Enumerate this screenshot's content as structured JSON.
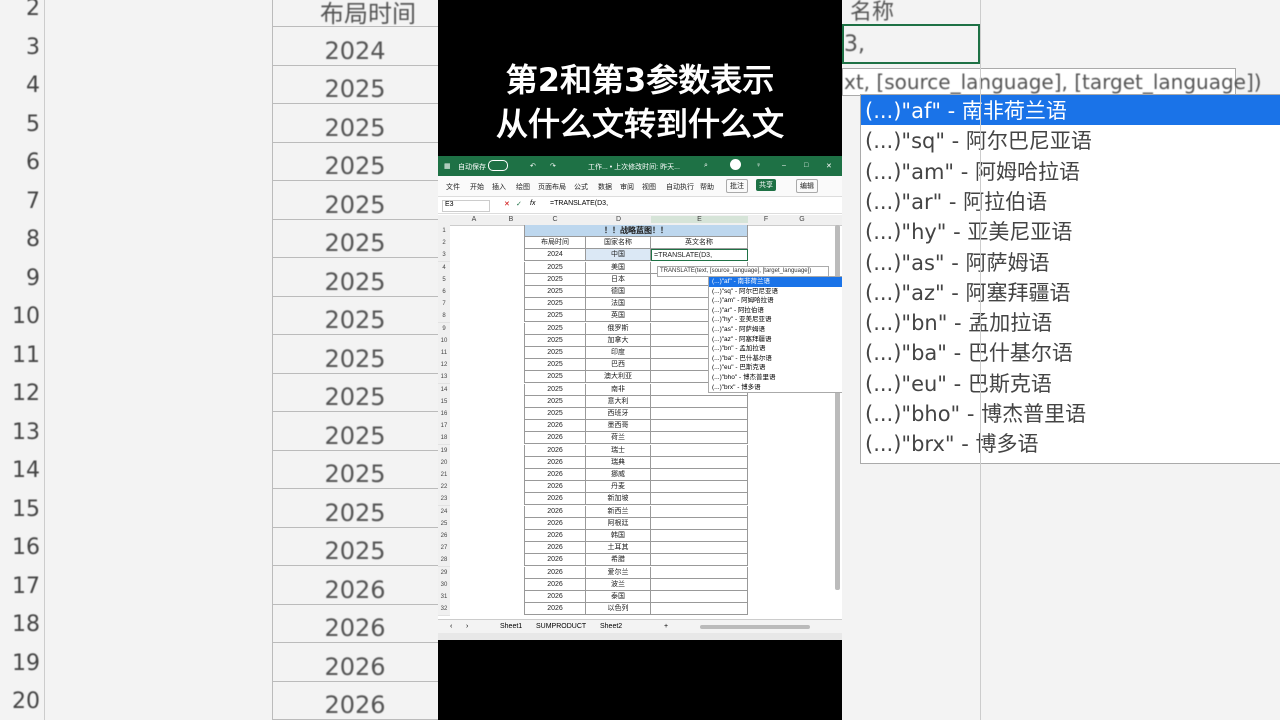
{
  "caption": {
    "line1": "第2和第3参数表示",
    "line2": "从什么文转到什么文"
  },
  "background_left": {
    "header_text": "布局时间",
    "row_numbers": [
      "2",
      "3",
      "4",
      "5",
      "6",
      "7",
      "8",
      "9",
      "10",
      "11",
      "12",
      "13",
      "14",
      "15",
      "16",
      "17",
      "18",
      "19",
      "20"
    ],
    "years": [
      "2024",
      "2025",
      "2025",
      "2025",
      "2025",
      "2025",
      "2025",
      "2025",
      "2025",
      "2025",
      "2025",
      "2025",
      "2025",
      "2025",
      "2026",
      "2026",
      "2026",
      "2026"
    ]
  },
  "background_right": {
    "header_fragment": "名称",
    "cell_fragment": "3,",
    "tooltip": "xt, [source_language], [target_language])",
    "options": [
      "(...)\"af\" - 南非荷兰语",
      "(...)\"sq\" - 阿尔巴尼亚语",
      "(...)\"am\" - 阿姆哈拉语",
      "(...)\"ar\" - 阿拉伯语",
      "(...)\"hy\" - 亚美尼亚语",
      "(...)\"as\" - 阿萨姆语",
      "(...)\"az\" - 阿塞拜疆语",
      "(...)\"bn\" - 孟加拉语",
      "(...)\"ba\" - 巴什基尔语",
      "(...)\"eu\" - 巴斯克语",
      "(...)\"bho\" - 博杰普里语",
      "(...)\"brx\" - 博多语"
    ]
  },
  "excel": {
    "title_autosave": "自动保存",
    "title_file": "工作... • 上次修改时间: 昨天...",
    "menu": [
      "文件",
      "开始",
      "插入",
      "绘图",
      "页面布局",
      "公式",
      "数据",
      "审阅",
      "视图",
      "自动执行",
      "帮助"
    ],
    "btn_comment": "批注",
    "btn_share": "共享",
    "btn_edit": "编辑",
    "name_box": "E3",
    "formula": "=TRANSLATE(D3,",
    "columns": [
      "A",
      "B",
      "C",
      "D",
      "E",
      "F",
      "G"
    ],
    "table_title": "！！战略蓝图！！",
    "headers": [
      "布局时间",
      "国家名称",
      "英文名称"
    ],
    "rows": [
      [
        "2024",
        "中国"
      ],
      [
        "2025",
        "美国"
      ],
      [
        "2025",
        "日本"
      ],
      [
        "2025",
        "德国"
      ],
      [
        "2025",
        "法国"
      ],
      [
        "2025",
        "英国"
      ],
      [
        "2025",
        "俄罗斯"
      ],
      [
        "2025",
        "加拿大"
      ],
      [
        "2025",
        "印度"
      ],
      [
        "2025",
        "巴西"
      ],
      [
        "2025",
        "澳大利亚"
      ],
      [
        "2025",
        "南非"
      ],
      [
        "2025",
        "意大利"
      ],
      [
        "2025",
        "西班牙"
      ],
      [
        "2026",
        "墨西哥"
      ],
      [
        "2026",
        "荷兰"
      ],
      [
        "2026",
        "瑞士"
      ],
      [
        "2026",
        "瑞典"
      ],
      [
        "2026",
        "挪威"
      ],
      [
        "2026",
        "丹麦"
      ],
      [
        "2026",
        "新加坡"
      ],
      [
        "2026",
        "新西兰"
      ],
      [
        "2026",
        "阿根廷"
      ],
      [
        "2026",
        "韩国"
      ],
      [
        "2026",
        "土耳其"
      ],
      [
        "2026",
        "希腊"
      ],
      [
        "2026",
        "爱尔兰"
      ],
      [
        "2026",
        "波兰"
      ],
      [
        "2026",
        "泰国"
      ],
      [
        "2026",
        "以色列"
      ]
    ],
    "editing_cell": "=TRANSLATE(D3,",
    "tooltip": "TRANSLATE(text, [source_language], [target_language])",
    "dropdown": [
      "(...)\"af\" - 南非荷兰语",
      "(...)\"sq\" - 阿尔巴尼亚语",
      "(...)\"am\" - 阿姆哈拉语",
      "(...)\"ar\" - 阿拉伯语",
      "(...)\"hy\" - 亚美尼亚语",
      "(...)\"as\" - 阿萨姆语",
      "(...)\"az\" - 阿塞拜疆语",
      "(...)\"bn\" - 孟加拉语",
      "(...)\"ba\" - 巴什基尔语",
      "(...)\"eu\" - 巴斯克语",
      "(...)\"bho\" - 博杰普里语",
      "(...)\"brx\" - 博多语"
    ],
    "sheet_tabs": [
      "Sheet1",
      "SUMPRODUCT",
      "Sheet2"
    ],
    "accent": "#1e7145",
    "selection_color": "#1a73e8"
  }
}
